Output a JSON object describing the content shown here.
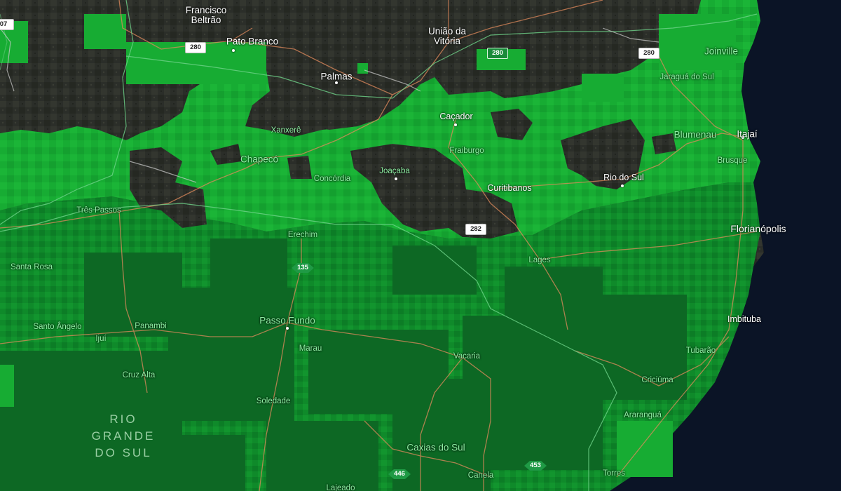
{
  "map": {
    "colors": {
      "ocean": "#0b1426",
      "land_dark": "#2c2f2a",
      "overlay_light": "#16b534",
      "overlay_mid": "#10a02d",
      "overlay_dark": "#0d6a24",
      "roads": "#e08a5c",
      "state_border": "#6fd38a"
    },
    "state_labels": {
      "rio_grande_do_sul": [
        "RIO",
        "GRANDE",
        "DO SUL"
      ]
    },
    "cities": [
      {
        "name": "Francisco\nBeltrão",
        "id": "francisco-beltrao"
      },
      {
        "name": "Pato Branco",
        "id": "pato-branco"
      },
      {
        "name": "União da\nVitória",
        "id": "uniao-da-vitoria"
      },
      {
        "name": "Palmas",
        "id": "palmas"
      },
      {
        "name": "Joinville",
        "id": "joinville"
      },
      {
        "name": "Jaraguá do Sul",
        "id": "jaragua-do-sul"
      },
      {
        "name": "Caçador",
        "id": "cacador"
      },
      {
        "name": "Xanxerê",
        "id": "xanxere"
      },
      {
        "name": "Blumenau",
        "id": "blumenau"
      },
      {
        "name": "Itajaí",
        "id": "itajai"
      },
      {
        "name": "Chapecó",
        "id": "chapeco"
      },
      {
        "name": "Fraiburgo",
        "id": "fraiburgo"
      },
      {
        "name": "Joaçaba",
        "id": "joacaba"
      },
      {
        "name": "Rio do Sul",
        "id": "rio-do-sul"
      },
      {
        "name": "Brusque",
        "id": "brusque"
      },
      {
        "name": "Concórdia",
        "id": "concordia"
      },
      {
        "name": "Curitibanos",
        "id": "curitibanos"
      },
      {
        "name": "Três Passos",
        "id": "tres-passos"
      },
      {
        "name": "Florianópolis",
        "id": "florianopolis"
      },
      {
        "name": "Erechim",
        "id": "erechim"
      },
      {
        "name": "Lages",
        "id": "lages"
      },
      {
        "name": "Santa Rosa",
        "id": "santa-rosa"
      },
      {
        "name": "Passo Fundo",
        "id": "passo-fundo"
      },
      {
        "name": "Imbituba",
        "id": "imbituba"
      },
      {
        "name": "Santo Ângelo",
        "id": "santo-angelo"
      },
      {
        "name": "Panambi",
        "id": "panambi"
      },
      {
        "name": "Ijuí",
        "id": "ijui"
      },
      {
        "name": "Marau",
        "id": "marau"
      },
      {
        "name": "Tubarão",
        "id": "tubarao"
      },
      {
        "name": "Vacaria",
        "id": "vacaria"
      },
      {
        "name": "Cruz Alta",
        "id": "cruz-alta"
      },
      {
        "name": "Criciúma",
        "id": "criciuma"
      },
      {
        "name": "Soledade",
        "id": "soledade"
      },
      {
        "name": "Araranguá",
        "id": "ararangua"
      },
      {
        "name": "Caxias do Sul",
        "id": "caxias-do-sul"
      },
      {
        "name": "Canela",
        "id": "canela"
      },
      {
        "name": "Torres",
        "id": "torres"
      },
      {
        "name": "Lajeado",
        "id": "lajeado"
      }
    ],
    "shields": [
      {
        "label": "280",
        "id": "br-280-west"
      },
      {
        "label": "280",
        "id": "br-280-center"
      },
      {
        "label": "280",
        "id": "br-280-east"
      },
      {
        "label": "282",
        "id": "br-282"
      },
      {
        "label": "135",
        "id": "rs-135"
      },
      {
        "label": "446",
        "id": "rs-446"
      },
      {
        "label": "453",
        "id": "rs-453"
      },
      {
        "label": "07",
        "id": "edge-07"
      }
    ]
  }
}
